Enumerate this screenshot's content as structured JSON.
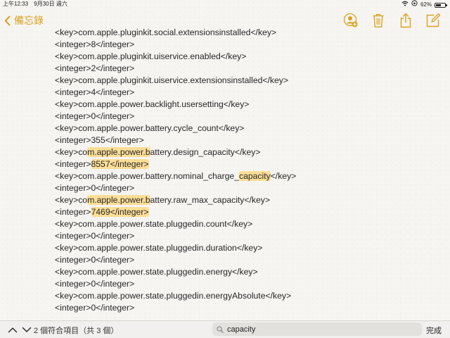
{
  "status_bar": {
    "time": "上午12:33",
    "date": "9月30日 週六",
    "battery": "62%",
    "battery_level": 0.62
  },
  "nav": {
    "back_label": "備忘錄"
  },
  "note": {
    "lines": [
      {
        "pre": "<key>com.apple.pluginkit.social.extensionsinstalled</key>",
        "hl": "",
        "post": ""
      },
      {
        "pre": "<integer>8</integer>",
        "hl": "",
        "post": ""
      },
      {
        "pre": "<key>com.apple.pluginkit.uiservice.enabled</key>",
        "hl": "",
        "post": ""
      },
      {
        "pre": "<integer>2</integer>",
        "hl": "",
        "post": ""
      },
      {
        "pre": "<key>com.apple.pluginkit.uiservice.extensionsinstalled</key>",
        "hl": "",
        "post": ""
      },
      {
        "pre": "<integer>4</integer>",
        "hl": "",
        "post": ""
      },
      {
        "pre": "<key>com.apple.power.backlight.usersetting</key>",
        "hl": "",
        "post": ""
      },
      {
        "pre": "<integer>0</integer>",
        "hl": "",
        "post": ""
      },
      {
        "pre": "<key>com.apple.power.battery.cycle_count</key>",
        "hl": "",
        "post": ""
      },
      {
        "pre": "<integer>355</integer>",
        "hl": "",
        "post": ""
      },
      {
        "pre": "<key>co",
        "hl": "m.apple.power.b",
        "post": "attery.design_capacity</key>"
      },
      {
        "pre": "<integer>",
        "hl": "8557</integer>",
        "post": ""
      },
      {
        "pre": "<key>com.apple.power.battery.nominal_charge_",
        "hl": "capacity",
        "post": "</key>"
      },
      {
        "pre": "<integer>0</integer>",
        "hl": "",
        "post": ""
      },
      {
        "pre": "<key>co",
        "hl": "m.apple.power.b",
        "post": "attery.raw_max_capacity</key>"
      },
      {
        "pre": "<integer>",
        "hl": "7469</integer>",
        "post": ""
      },
      {
        "pre": "<key>com.apple.power.state.pluggedin.count</key>",
        "hl": "",
        "post": ""
      },
      {
        "pre": "<integer>0</integer>",
        "hl": "",
        "post": ""
      },
      {
        "pre": "<key>com.apple.power.state.pluggedin.duration</key>",
        "hl": "",
        "post": ""
      },
      {
        "pre": "<integer>0</integer>",
        "hl": "",
        "post": ""
      },
      {
        "pre": "<key>com.apple.power.state.pluggedin.energy</key>",
        "hl": "",
        "post": ""
      },
      {
        "pre": "<integer>0</integer>",
        "hl": "",
        "post": ""
      },
      {
        "pre": "<key>com.apple.power.state.pluggedin.energyAbsolute</key>",
        "hl": "",
        "post": ""
      },
      {
        "pre": "<integer>0</integer>",
        "hl": "",
        "post": ""
      }
    ]
  },
  "find_bar": {
    "match_count": "2 個符合項目（共 3 個）",
    "search_value": "capacity",
    "done_label": "完成"
  },
  "colors": {
    "accent": "#d9a321",
    "highlight": "#ffd678"
  }
}
